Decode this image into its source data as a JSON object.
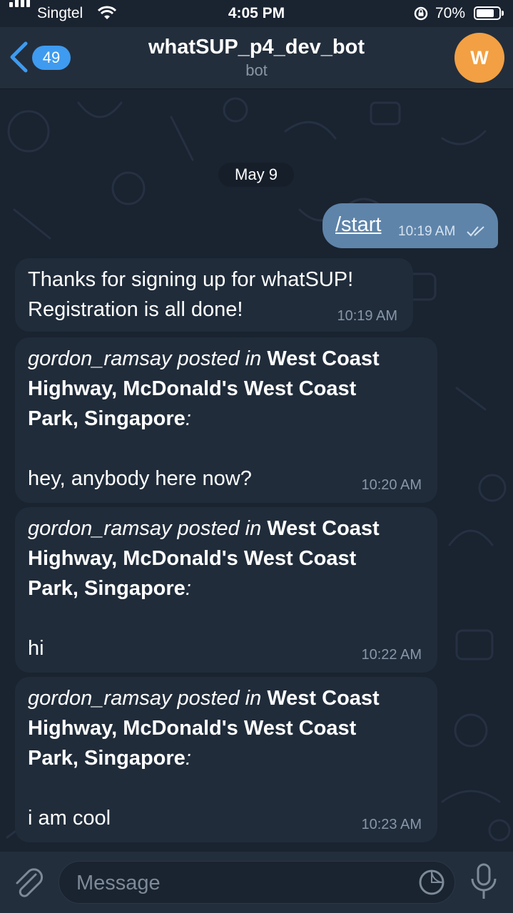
{
  "status_bar": {
    "carrier": "Singtel",
    "time": "4:05 PM",
    "battery": "70%",
    "icons": [
      "signal-icon",
      "wifi-icon",
      "rotation-lock-icon",
      "battery-icon"
    ]
  },
  "header": {
    "back_count": "49",
    "title": "whatSUP_p4_dev_bot",
    "subtitle": "bot",
    "avatar_letter": "W",
    "avatar_color": "#f2a043"
  },
  "chat": {
    "date": "May 9",
    "outgoing": {
      "text": "/start",
      "time": "10:19 AM"
    },
    "incoming_welcome": {
      "line1": "Thanks for signing up for whatSUP!",
      "line2": "Registration is all done!",
      "time": "10:19 AM"
    },
    "posts": [
      {
        "author_prefix": "gordon_ramsay posted in ",
        "location_line1": "West Coast",
        "location_line2": "Highway, McDonald's West Coast",
        "location_line3": "Park, Singapore",
        "colon": ":",
        "body": "hey, anybody here now?",
        "time": "10:20 AM"
      },
      {
        "author_prefix": "gordon_ramsay posted in ",
        "location_line1": "West Coast",
        "location_line2": "Highway, McDonald's West Coast",
        "location_line3": "Park, Singapore",
        "colon": ":",
        "body": "hi",
        "time": "10:22 AM"
      },
      {
        "author_prefix": "gordon_ramsay posted in ",
        "location_line1": "West Coast",
        "location_line2": "Highway, McDonald's West Coast",
        "location_line3": "Park, Singapore",
        "colon": ":",
        "body": "i am cool",
        "time": "10:23 AM"
      }
    ]
  },
  "input_bar": {
    "placeholder": "Message"
  },
  "colors": {
    "background": "#1a2330",
    "header": "#232e3c",
    "incoming_bubble": "#202c3a",
    "outgoing_bubble": "#5e84aa",
    "accent": "#3e9bef"
  }
}
